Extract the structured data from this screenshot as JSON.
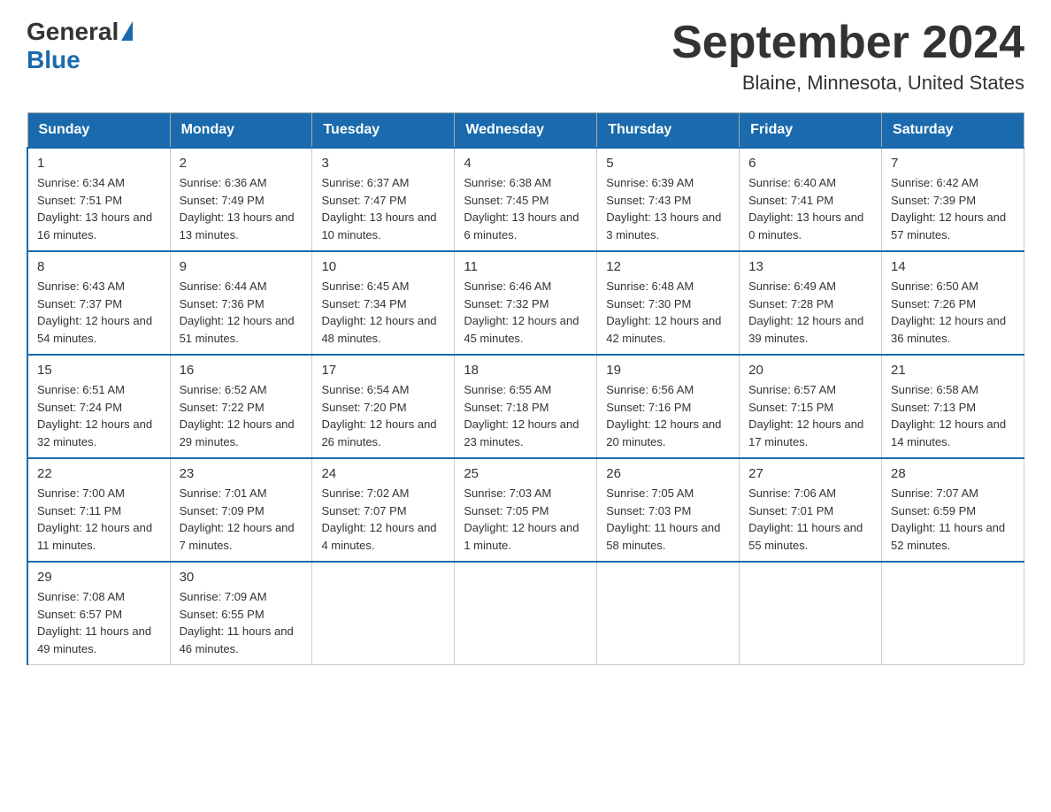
{
  "header": {
    "logo_general": "General",
    "logo_blue": "Blue",
    "month_title": "September 2024",
    "location": "Blaine, Minnesota, United States"
  },
  "days_of_week": [
    "Sunday",
    "Monday",
    "Tuesday",
    "Wednesday",
    "Thursday",
    "Friday",
    "Saturday"
  ],
  "weeks": [
    [
      {
        "day": "1",
        "sunrise": "Sunrise: 6:34 AM",
        "sunset": "Sunset: 7:51 PM",
        "daylight": "Daylight: 13 hours and 16 minutes."
      },
      {
        "day": "2",
        "sunrise": "Sunrise: 6:36 AM",
        "sunset": "Sunset: 7:49 PM",
        "daylight": "Daylight: 13 hours and 13 minutes."
      },
      {
        "day": "3",
        "sunrise": "Sunrise: 6:37 AM",
        "sunset": "Sunset: 7:47 PM",
        "daylight": "Daylight: 13 hours and 10 minutes."
      },
      {
        "day": "4",
        "sunrise": "Sunrise: 6:38 AM",
        "sunset": "Sunset: 7:45 PM",
        "daylight": "Daylight: 13 hours and 6 minutes."
      },
      {
        "day": "5",
        "sunrise": "Sunrise: 6:39 AM",
        "sunset": "Sunset: 7:43 PM",
        "daylight": "Daylight: 13 hours and 3 minutes."
      },
      {
        "day": "6",
        "sunrise": "Sunrise: 6:40 AM",
        "sunset": "Sunset: 7:41 PM",
        "daylight": "Daylight: 13 hours and 0 minutes."
      },
      {
        "day": "7",
        "sunrise": "Sunrise: 6:42 AM",
        "sunset": "Sunset: 7:39 PM",
        "daylight": "Daylight: 12 hours and 57 minutes."
      }
    ],
    [
      {
        "day": "8",
        "sunrise": "Sunrise: 6:43 AM",
        "sunset": "Sunset: 7:37 PM",
        "daylight": "Daylight: 12 hours and 54 minutes."
      },
      {
        "day": "9",
        "sunrise": "Sunrise: 6:44 AM",
        "sunset": "Sunset: 7:36 PM",
        "daylight": "Daylight: 12 hours and 51 minutes."
      },
      {
        "day": "10",
        "sunrise": "Sunrise: 6:45 AM",
        "sunset": "Sunset: 7:34 PM",
        "daylight": "Daylight: 12 hours and 48 minutes."
      },
      {
        "day": "11",
        "sunrise": "Sunrise: 6:46 AM",
        "sunset": "Sunset: 7:32 PM",
        "daylight": "Daylight: 12 hours and 45 minutes."
      },
      {
        "day": "12",
        "sunrise": "Sunrise: 6:48 AM",
        "sunset": "Sunset: 7:30 PM",
        "daylight": "Daylight: 12 hours and 42 minutes."
      },
      {
        "day": "13",
        "sunrise": "Sunrise: 6:49 AM",
        "sunset": "Sunset: 7:28 PM",
        "daylight": "Daylight: 12 hours and 39 minutes."
      },
      {
        "day": "14",
        "sunrise": "Sunrise: 6:50 AM",
        "sunset": "Sunset: 7:26 PM",
        "daylight": "Daylight: 12 hours and 36 minutes."
      }
    ],
    [
      {
        "day": "15",
        "sunrise": "Sunrise: 6:51 AM",
        "sunset": "Sunset: 7:24 PM",
        "daylight": "Daylight: 12 hours and 32 minutes."
      },
      {
        "day": "16",
        "sunrise": "Sunrise: 6:52 AM",
        "sunset": "Sunset: 7:22 PM",
        "daylight": "Daylight: 12 hours and 29 minutes."
      },
      {
        "day": "17",
        "sunrise": "Sunrise: 6:54 AM",
        "sunset": "Sunset: 7:20 PM",
        "daylight": "Daylight: 12 hours and 26 minutes."
      },
      {
        "day": "18",
        "sunrise": "Sunrise: 6:55 AM",
        "sunset": "Sunset: 7:18 PM",
        "daylight": "Daylight: 12 hours and 23 minutes."
      },
      {
        "day": "19",
        "sunrise": "Sunrise: 6:56 AM",
        "sunset": "Sunset: 7:16 PM",
        "daylight": "Daylight: 12 hours and 20 minutes."
      },
      {
        "day": "20",
        "sunrise": "Sunrise: 6:57 AM",
        "sunset": "Sunset: 7:15 PM",
        "daylight": "Daylight: 12 hours and 17 minutes."
      },
      {
        "day": "21",
        "sunrise": "Sunrise: 6:58 AM",
        "sunset": "Sunset: 7:13 PM",
        "daylight": "Daylight: 12 hours and 14 minutes."
      }
    ],
    [
      {
        "day": "22",
        "sunrise": "Sunrise: 7:00 AM",
        "sunset": "Sunset: 7:11 PM",
        "daylight": "Daylight: 12 hours and 11 minutes."
      },
      {
        "day": "23",
        "sunrise": "Sunrise: 7:01 AM",
        "sunset": "Sunset: 7:09 PM",
        "daylight": "Daylight: 12 hours and 7 minutes."
      },
      {
        "day": "24",
        "sunrise": "Sunrise: 7:02 AM",
        "sunset": "Sunset: 7:07 PM",
        "daylight": "Daylight: 12 hours and 4 minutes."
      },
      {
        "day": "25",
        "sunrise": "Sunrise: 7:03 AM",
        "sunset": "Sunset: 7:05 PM",
        "daylight": "Daylight: 12 hours and 1 minute."
      },
      {
        "day": "26",
        "sunrise": "Sunrise: 7:05 AM",
        "sunset": "Sunset: 7:03 PM",
        "daylight": "Daylight: 11 hours and 58 minutes."
      },
      {
        "day": "27",
        "sunrise": "Sunrise: 7:06 AM",
        "sunset": "Sunset: 7:01 PM",
        "daylight": "Daylight: 11 hours and 55 minutes."
      },
      {
        "day": "28",
        "sunrise": "Sunrise: 7:07 AM",
        "sunset": "Sunset: 6:59 PM",
        "daylight": "Daylight: 11 hours and 52 minutes."
      }
    ],
    [
      {
        "day": "29",
        "sunrise": "Sunrise: 7:08 AM",
        "sunset": "Sunset: 6:57 PM",
        "daylight": "Daylight: 11 hours and 49 minutes."
      },
      {
        "day": "30",
        "sunrise": "Sunrise: 7:09 AM",
        "sunset": "Sunset: 6:55 PM",
        "daylight": "Daylight: 11 hours and 46 minutes."
      },
      null,
      null,
      null,
      null,
      null
    ]
  ]
}
